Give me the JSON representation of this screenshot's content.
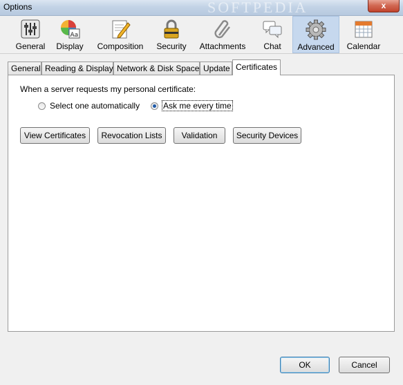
{
  "window": {
    "title": "Options",
    "close_label": "x",
    "watermark": "SOFTPEDIA"
  },
  "toolbar": {
    "items": [
      {
        "label": "General",
        "icon": "sliders-icon"
      },
      {
        "label": "Display",
        "icon": "color-font-icon"
      },
      {
        "label": "Composition",
        "icon": "pencil-paper-icon"
      },
      {
        "label": "Security",
        "icon": "padlock-icon"
      },
      {
        "label": "Attachments",
        "icon": "paperclip-icon"
      },
      {
        "label": "Chat",
        "icon": "speech-bubbles-icon"
      },
      {
        "label": "Advanced",
        "icon": "gear-icon",
        "selected": true
      },
      {
        "label": "Calendar",
        "icon": "calendar-icon"
      }
    ]
  },
  "tabs": [
    {
      "label": "General"
    },
    {
      "label": "Reading & Display"
    },
    {
      "label": "Network & Disk Space"
    },
    {
      "label": "Update"
    },
    {
      "label": "Certificates",
      "selected": true
    }
  ],
  "certificates": {
    "question": "When a server requests my personal certificate:",
    "options": [
      {
        "label": "Select one automatically",
        "checked": false
      },
      {
        "label": "Ask me every time",
        "checked": true
      }
    ],
    "buttons": {
      "view": "View Certificates",
      "revocation": "Revocation Lists",
      "validation": "Validation",
      "devices": "Security Devices"
    }
  },
  "dialog": {
    "ok_label": "OK",
    "cancel_label": "Cancel"
  }
}
